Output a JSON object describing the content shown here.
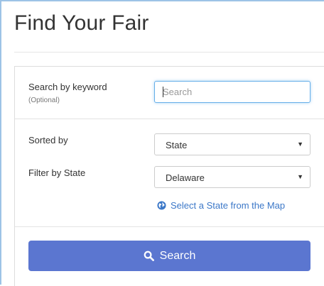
{
  "header": {
    "title": "Find Your Fair"
  },
  "form": {
    "keyword": {
      "label": "Search by keyword",
      "sublabel": "(Optional)",
      "placeholder": "Search",
      "value": ""
    },
    "sort": {
      "label": "Sorted by",
      "selected": "State"
    },
    "state_filter": {
      "label": "Filter by State",
      "selected": "Delaware"
    },
    "map_link": {
      "icon": "globe-icon",
      "label": "Select a State from the Map"
    },
    "submit": {
      "icon": "search-icon",
      "label": "Search"
    }
  },
  "colors": {
    "button_bg": "#5b76d0",
    "link": "#3c78c8",
    "focus_border": "#66afe9"
  }
}
